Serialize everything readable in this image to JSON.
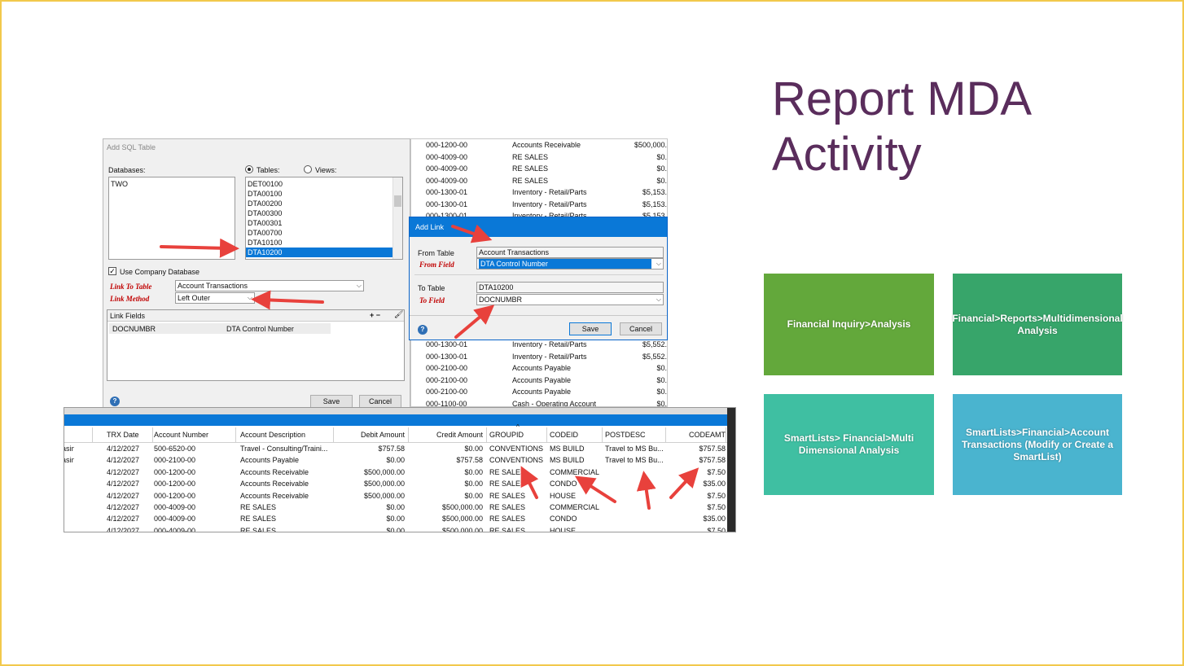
{
  "slide": {
    "title_line1": "Report MDA",
    "title_line2": "Activity"
  },
  "tiles": [
    {
      "label": "Financial Inquiry>Analysis",
      "color": "#63a83b"
    },
    {
      "label": "Financial>Reports>Multidimensional Analysis",
      "color": "#37a56a"
    },
    {
      "label": "SmartLists> Financial>Multi Dimensional Analysis",
      "color": "#3fbfa2"
    },
    {
      "label": "SmartLists>Financial>Account Transactions (Modify or Create a SmartList)",
      "color": "#4ab4cf"
    }
  ],
  "sql_window": {
    "caption": "Add SQL Table",
    "databases_label": "Databases:",
    "databases": [
      "TWO"
    ],
    "tables_radio": "Tables:",
    "views_radio": "Views:",
    "tables": [
      "DET00100",
      "DTA00100",
      "DTA00200",
      "DTA00300",
      "DTA00301",
      "DTA00700",
      "DTA10100",
      "DTA10200"
    ],
    "selected_table": "DTA10200",
    "use_company_db": "Use Company Database",
    "link_to_table_label": "Link To Table",
    "link_to_table_value": "Account Transactions",
    "link_method_label": "Link Method",
    "link_method_value": "Left Outer",
    "link_fields_label": "Link Fields",
    "link_fields_tools": "+ −",
    "link_field_row": {
      "from": "DOCNUMBR",
      "to": "DTA Control Number"
    },
    "help": "?",
    "save": "Save",
    "cancel": "Cancel"
  },
  "account_strip": {
    "top_rows": [
      {
        "acct": "000-1200-00",
        "desc": "Accounts Receivable",
        "amt": "$500,000."
      },
      {
        "acct": "000-4009-00",
        "desc": "RE SALES",
        "amt": "$0."
      },
      {
        "acct": "000-4009-00",
        "desc": "RE SALES",
        "amt": "$0."
      },
      {
        "acct": "000-4009-00",
        "desc": "RE SALES",
        "amt": "$0."
      },
      {
        "acct": "000-1300-01",
        "desc": "Inventory - Retail/Parts",
        "amt": "$5,153."
      },
      {
        "acct": "000-1300-01",
        "desc": "Inventory - Retail/Parts",
        "amt": "$5,153."
      },
      {
        "acct": "000-1300-01",
        "desc": "Inventory - Retail/Parts",
        "amt": "$5,153."
      }
    ],
    "bottom_rows": [
      {
        "acct": "000-1300-01",
        "desc": "Inventory - Retail/Parts",
        "amt": "$5,552."
      },
      {
        "acct": "000-1300-01",
        "desc": "Inventory - Retail/Parts",
        "amt": "$5,552."
      },
      {
        "acct": "000-2100-00",
        "desc": "Accounts Payable",
        "amt": "$0."
      },
      {
        "acct": "000-2100-00",
        "desc": "Accounts Payable",
        "amt": "$0."
      },
      {
        "acct": "000-2100-00",
        "desc": "Accounts Payable",
        "amt": "$0."
      },
      {
        "acct": "000-1100-00",
        "desc": "Cash - Operating Account",
        "amt": "$0."
      }
    ]
  },
  "link_dialog": {
    "title": "Add Link",
    "from_table_label": "From Table",
    "from_table_value": "Account Transactions",
    "from_field_label": "From Field",
    "from_field_value": "DTA Control Number",
    "to_table_label": "To Table",
    "to_table_value": "DTA10200",
    "to_field_label": "To Field",
    "to_field_value": "DOCNUMBR",
    "help": "?",
    "save": "Save",
    "cancel": "Cancel"
  },
  "grid": {
    "headers": [
      "s",
      "TRX Date",
      "Account Number",
      "Account Description",
      "Debit Amount",
      "Credit Amount",
      "GROUPID",
      "CODEID",
      "POSTDESC",
      "CODEAMT"
    ],
    "rows": [
      [
        "hasing",
        "4/12/2027",
        "500-6520-00",
        "Travel - Consulting/Traini...",
        "$757.58",
        "$0.00",
        "CONVENTIONS",
        "MS BUILD",
        "Travel to MS Bu...",
        "$757.58"
      ],
      [
        "hasing",
        "4/12/2027",
        "000-2100-00",
        "Accounts Payable",
        "$0.00",
        "$757.58",
        "CONVENTIONS",
        "MS BUILD",
        "Travel to MS Bu...",
        "$757.58"
      ],
      [
        "",
        "4/12/2027",
        "000-1200-00",
        "Accounts Receivable",
        "$500,000.00",
        "$0.00",
        "RE SALES",
        "COMMERCIAL",
        "",
        "$7.50"
      ],
      [
        "",
        "4/12/2027",
        "000-1200-00",
        "Accounts Receivable",
        "$500,000.00",
        "$0.00",
        "RE SALES",
        "CONDO",
        "",
        "$35.00"
      ],
      [
        "",
        "4/12/2027",
        "000-1200-00",
        "Accounts Receivable",
        "$500,000.00",
        "$0.00",
        "RE SALES",
        "HOUSE",
        "",
        "$7.50"
      ],
      [
        "",
        "4/12/2027",
        "000-4009-00",
        "RE SALES",
        "$0.00",
        "$500,000.00",
        "RE SALES",
        "COMMERCIAL",
        "",
        "$7.50"
      ],
      [
        "",
        "4/12/2027",
        "000-4009-00",
        "RE SALES",
        "$0.00",
        "$500,000.00",
        "RE SALES",
        "CONDO",
        "",
        "$35.00"
      ],
      [
        "",
        "4/12/2027",
        "000-4009-00",
        "RE SALES",
        "$0.00",
        "$500,000.00",
        "RE SALES",
        "HOUSE",
        "",
        "$7.50"
      ]
    ]
  },
  "colors": {
    "title": "#5a2d5c",
    "arrow": "#e8413c",
    "accent_blue": "#0a78d7",
    "frame": "#f2c94c"
  }
}
